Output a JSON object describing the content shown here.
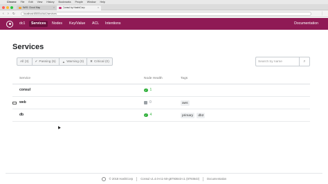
{
  "menubar": {
    "items": [
      "Chrome",
      "File",
      "Edit",
      "View",
      "History",
      "Bookmarks",
      "People",
      "Window",
      "Help"
    ]
  },
  "browser": {
    "tabs": [
      {
        "title": "AWS: Cloud Map",
        "active": false
      },
      {
        "title": "Consul by HashiCorp",
        "active": true
      }
    ],
    "url": "localhost:8500/ui/dc1/services"
  },
  "topnav": {
    "datacenter": "dc1",
    "items": [
      "Services",
      "Nodes",
      "Key/Value",
      "ACL",
      "Intentions"
    ],
    "active": "Services",
    "right": "Documentation"
  },
  "page": {
    "title": "Services"
  },
  "filters": [
    {
      "label": "All (3)",
      "icon": ""
    },
    {
      "label": "Passing (5)",
      "icon": "check-icon"
    },
    {
      "label": "Warning (0)",
      "icon": "warning-icon"
    },
    {
      "label": "Critical (0)",
      "icon": "critical-icon"
    }
  ],
  "search": {
    "placeholder": "Search by name",
    "value": ""
  },
  "table": {
    "headers": [
      "Service",
      "Node Health",
      "Tags"
    ],
    "rows": [
      {
        "name": "consul",
        "has_icon": false,
        "health_count": "1",
        "health_status": "passing",
        "tags": []
      },
      {
        "name": "web",
        "has_icon": true,
        "health_count": "0",
        "health_status": "none",
        "tags": [
          "aws"
        ]
      },
      {
        "name": "db",
        "has_icon": false,
        "health_count": "4",
        "health_status": "passing",
        "tags": [
          "primary",
          "db2"
        ]
      }
    ]
  },
  "footer": {
    "copyright": "© 2018 HashiCorp",
    "version": "Consul v1.4.0-rc1-50-g8793643-c1 (8793643)",
    "docs_link": "Documentation"
  },
  "colors": {
    "brand": "#8f1a55",
    "brand_active": "#6b0f3e",
    "passing": "#2eb039"
  }
}
